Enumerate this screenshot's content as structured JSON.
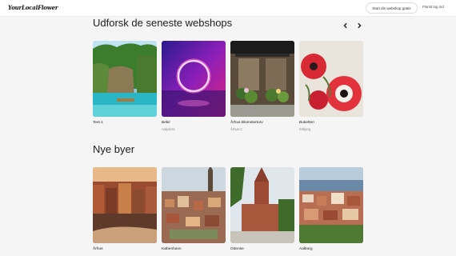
{
  "header": {
    "logo_text": "YourLocalFlower",
    "start_button_label": "Start din webshop gratis",
    "login_label": "Florist log ind"
  },
  "shops_section": {
    "title": "Udforsk de seneste webshops",
    "items": [
      {
        "name": "Test 1",
        "location": ""
      },
      {
        "name": "Bekir",
        "location": "Aalyders"
      },
      {
        "name": "Århus Blomstertorv",
        "location": "Århus C"
      },
      {
        "name": "Buketten",
        "location": "Esbjerg"
      }
    ]
  },
  "cities_section": {
    "title": "Nye byer",
    "items": [
      {
        "name": "Århus"
      },
      {
        "name": "København"
      },
      {
        "name": "Odense"
      },
      {
        "name": "Aalborg"
      }
    ]
  },
  "icons": {
    "prev": "chevron-left-icon",
    "next": "chevron-right-icon"
  }
}
